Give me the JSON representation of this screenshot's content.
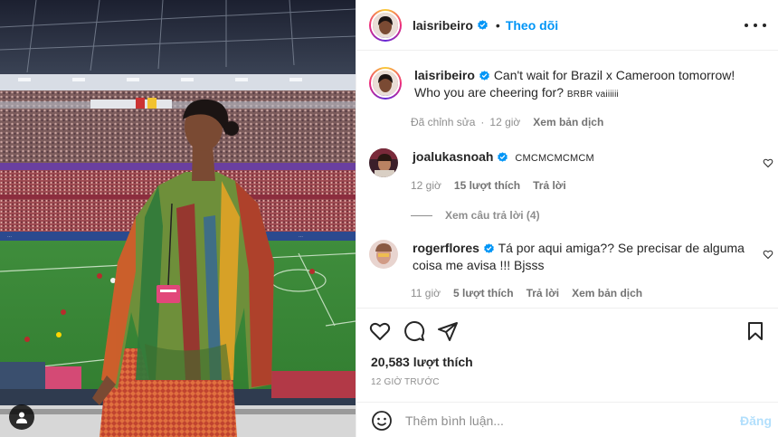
{
  "post": {
    "author": "laisribeiro",
    "follow_label": "Theo dõi",
    "dot": "•"
  },
  "caption": {
    "username": "laisribeiro",
    "text": "Can't wait for Brazil x Cameroon tomorrow! Who you are cheering for?",
    "small_text": "BRBR vaiiiiii",
    "edited": "Đã chỉnh sửa",
    "time": "12 giờ",
    "translate": "Xem bản dịch"
  },
  "comments": [
    {
      "username": "joalukasnoah",
      "text": "CMCMCMCMCM",
      "time": "12 giờ",
      "likes": "15 lượt thích",
      "reply": "Trả lời",
      "view_replies": "Xem câu trả lời (4)"
    },
    {
      "username": "rogerflores",
      "text": "Tá por aqui amiga?? Se precisar de alguma coisa me avisa !!! Bjsss",
      "time": "11 giờ",
      "likes": "5 lượt thích",
      "reply": "Trả lời",
      "translate": "Xem bản dịch"
    }
  ],
  "engagement": {
    "likes": "20,583 lượt thích",
    "timestamp": "12 GIỜ TRƯỚC"
  },
  "composer": {
    "placeholder": "Thêm bình luận...",
    "post_label": "Đăng"
  },
  "colors": {
    "accent": "#0095f6",
    "verified": "#0095f6",
    "muted": "#8e8e8e",
    "post_disabled": "#b2dffc"
  },
  "icons": [
    "verified-badge-icon",
    "more-options-icon",
    "heart-icon",
    "comment-icon",
    "share-icon",
    "bookmark-icon",
    "emoji-icon",
    "tagged-user-icon"
  ]
}
